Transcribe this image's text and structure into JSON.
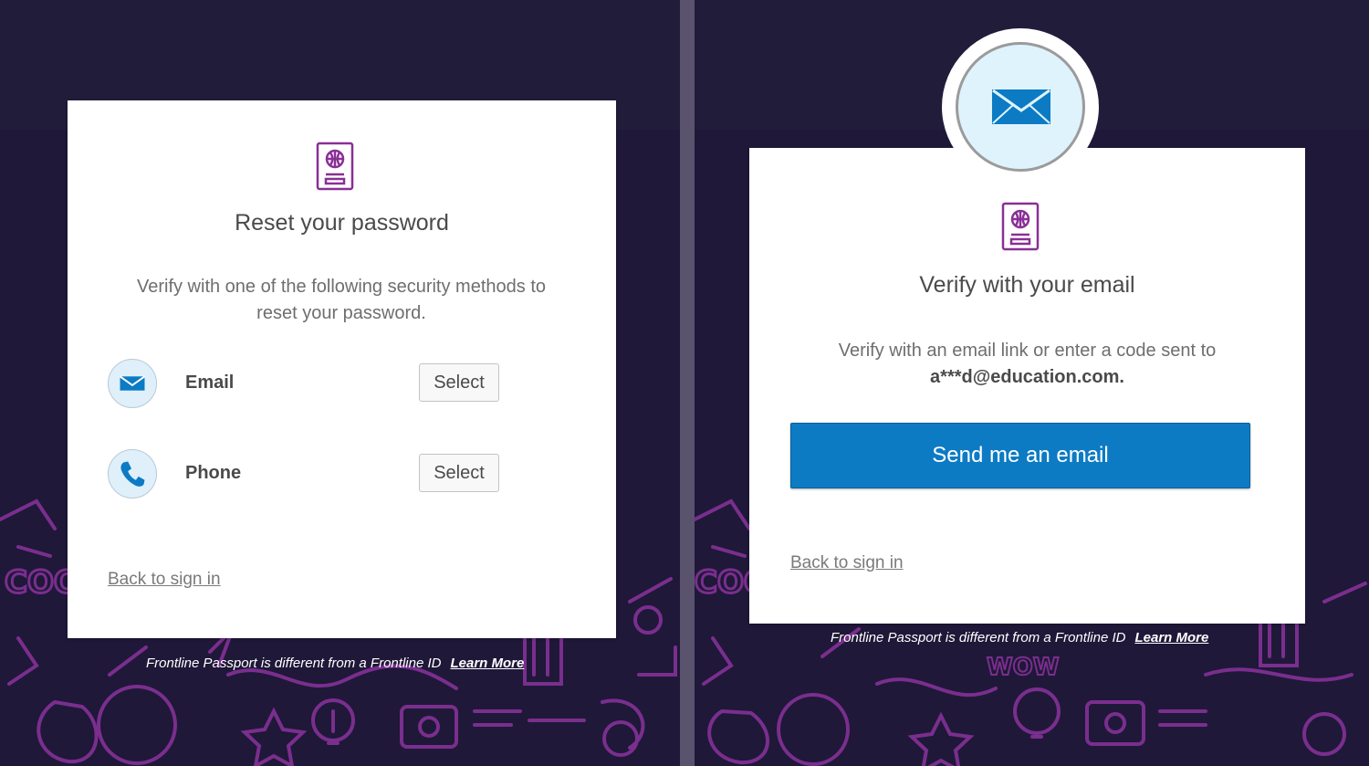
{
  "colors": {
    "background": "#1f1838",
    "doodle": "#7a2e8e",
    "primary_button": "#0c7bc4",
    "icon_blue": "#0c7bc4",
    "brand_purple": "#8a2f96"
  },
  "reset_screen": {
    "brand_icon": "passport-icon",
    "title": "Reset your password",
    "description": "Verify with one of the following security methods to reset your password.",
    "methods": [
      {
        "icon": "envelope-icon",
        "label": "Email",
        "button": "Select"
      },
      {
        "icon": "phone-icon",
        "label": "Phone",
        "button": "Select"
      }
    ],
    "back_link": "Back to sign in",
    "footer_text": "Frontline Passport is different from a Frontline ID",
    "footer_link": "Learn More"
  },
  "verify_screen": {
    "header_icon": "envelope-icon",
    "brand_icon": "passport-icon",
    "title": "Verify with your email",
    "description": "Verify with an email link or enter a code sent to",
    "masked_email": "a***d@education.com.",
    "send_button": "Send me an email",
    "back_link": "Back to sign in",
    "footer_text": "Frontline Passport is different from a Frontline ID",
    "footer_link": "Learn More"
  }
}
